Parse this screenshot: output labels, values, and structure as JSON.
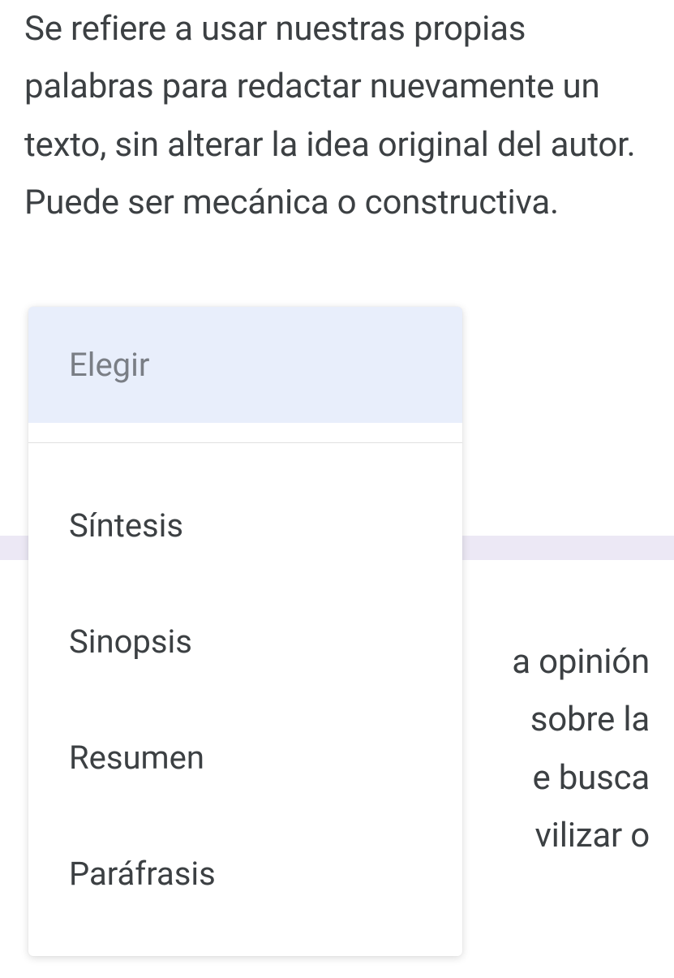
{
  "question1": {
    "text": "Se refiere a usar nuestras propias palabras para redactar nuevamente un texto, sin alterar la idea original del autor. Puede ser mecánica o constructiva."
  },
  "question2": {
    "text_fragment": "a opinión sobre la e busca vilizar o"
  },
  "dropdown": {
    "placeholder": "Elegir",
    "options": [
      "Síntesis",
      "Sinopsis",
      "Resumen",
      "Paráfrasis"
    ]
  }
}
